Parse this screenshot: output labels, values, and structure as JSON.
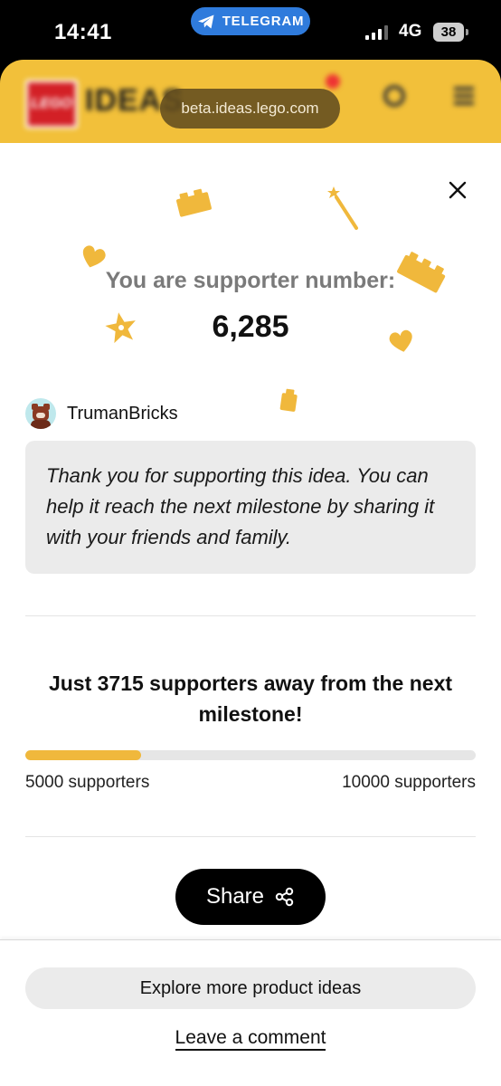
{
  "status_bar": {
    "time": "14:41",
    "telegram_label": "TELEGRAM",
    "network": "4G",
    "battery": "38"
  },
  "background_page": {
    "logo_text": "LEGO",
    "site_word": "IDEAS",
    "url": "beta.ideas.lego.com"
  },
  "modal": {
    "heading": "You are supporter number:",
    "supporter_number": "6,285",
    "user": {
      "name": "TrumanBricks"
    },
    "message": "Thank you for supporting this idea. You can help it reach the next milestone by sharing it with your friends and family.",
    "milestone_text": "Just 3715 supporters away from the next milestone!",
    "progress": {
      "fraction": 0.257,
      "start_label": "5000 supporters",
      "end_label": "10000 supporters"
    },
    "share_label": "Share",
    "accent_color": "#f0b83c"
  },
  "bottom": {
    "explore_label": "Explore more product ideas",
    "comment_label": "Leave a comment"
  }
}
